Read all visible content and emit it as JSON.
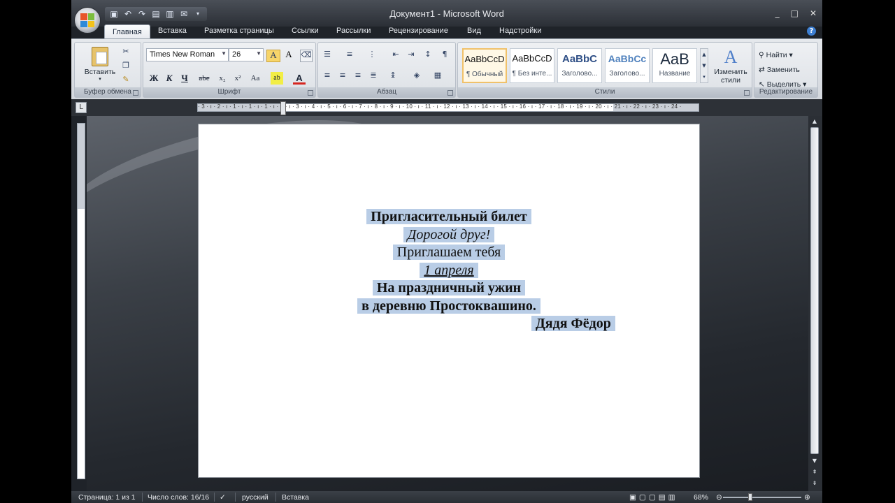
{
  "window": {
    "title": "Документ1 - Microsoft Word",
    "controls": [
      "_",
      "□",
      "✕"
    ]
  },
  "quick_access": [
    "save-icon",
    "undo-icon",
    "redo-icon",
    "print-preview-icon",
    "print-icon",
    "email-icon"
  ],
  "tabs": [
    "Главная",
    "Вставка",
    "Разметка страницы",
    "Ссылки",
    "Рассылки",
    "Рецензирование",
    "Вид",
    "Надстройки"
  ],
  "active_tab": "Главная",
  "ribbon": {
    "clipboard": {
      "label": "Буфер обмена",
      "paste": "Вставить"
    },
    "font": {
      "label": "Шрифт",
      "font_name": "Times New Roman",
      "font_size": "26",
      "bold": "Ж",
      "italic": "К",
      "underline": "Ч",
      "strike": "abe",
      "subscript": "x₂",
      "superscript": "x²",
      "case": "Aa"
    },
    "paragraph": {
      "label": "Абзац"
    },
    "styles": {
      "label": "Стили",
      "items": [
        {
          "sample": "AaBbCcD",
          "name": "¶ Обычный"
        },
        {
          "sample": "AaBbCcD",
          "name": "¶ Без инте..."
        },
        {
          "sample": "AaBbC",
          "name": "Заголово..."
        },
        {
          "sample": "AaBbCc",
          "name": "Заголово..."
        },
        {
          "sample": "AaB",
          "name": "Название"
        }
      ],
      "change_styles": "Изменить стили"
    },
    "editing": {
      "label": "Редактирование",
      "find": "Найти",
      "replace": "Заменить",
      "select": "Выделить"
    }
  },
  "ruler": {
    "numbers": "· 3 · ı · 2 · ı · 1 · ı · 1 · ı · 1 · ı · 2 · ı · 3 · ı · 4 · ı · 5 · ı · 6 · ı · 7 · ı · 8 · ı · 9 · ı · 10 · ı · 11 · ı · 12 · ı · 13 · ı · 14 · ı · 15 · ı · 16 · ı · 17 · ı · 18 · ı · 19 · ı · 20 · ı · 21 · ı · 22 · ı · 23 · ı · 24 ·"
  },
  "document": {
    "lines": [
      {
        "text": "Пригласительный билет",
        "style": "bold"
      },
      {
        "text": "Дорогой друг!",
        "style": "italic"
      },
      {
        "text": "Приглашаем тебя",
        "style": "normal"
      },
      {
        "text": "1 апреля",
        "style": "italic-underline"
      },
      {
        "text": "На праздничный ужин",
        "style": "bold"
      },
      {
        "text": "в деревню Простоквашино.",
        "style": "bold"
      },
      {
        "text": "Дядя Фёдор",
        "style": "bold-right"
      }
    ],
    "selection_color": "#b9cde6"
  },
  "status_bar": {
    "page": "Страница: 1 из 1",
    "words": "Число слов: 16/16",
    "language": "русский",
    "mode": "Вставка",
    "zoom": "68%"
  }
}
